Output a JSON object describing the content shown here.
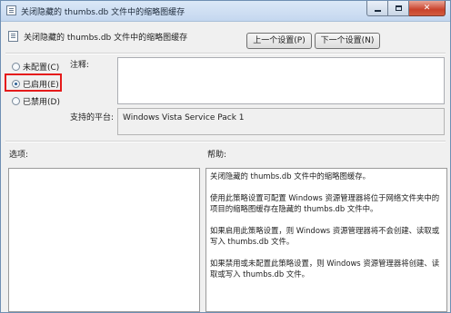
{
  "window": {
    "title": "关闭隐藏的 thumbs.db 文件中的缩略图缓存"
  },
  "header": {
    "policy_name": "关闭隐藏的 thumbs.db 文件中的缩略图缓存",
    "prev_button": "上一个设置(P)",
    "next_button": "下一个设置(N)"
  },
  "state_options": [
    {
      "label": "未配置(C)",
      "checked": false
    },
    {
      "label": "已启用(E)",
      "checked": true
    },
    {
      "label": "已禁用(D)",
      "checked": false
    }
  ],
  "comment": {
    "label": "注释:",
    "value": ""
  },
  "supported": {
    "label": "支持的平台:",
    "value": "Windows Vista Service Pack 1"
  },
  "options": {
    "label": "选项:"
  },
  "help": {
    "label": "帮助:",
    "paragraphs": [
      "关闭隐藏的 thumbs.db 文件中的缩略图缓存。",
      "使用此策略设置可配置 Windows 资源管理器将位于网络文件夹中的项目的缩略图缓存在隐藏的 thumbs.db 文件中。",
      "如果启用此策略设置，则 Windows 资源管理器将不会创建、读取或写入 thumbs.db 文件。",
      "如果禁用或未配置此策略设置，则 Windows 资源管理器将创建、读取或写入 thumbs.db 文件。"
    ]
  },
  "colors": {
    "highlight": "#e51b1b",
    "title_bar": "#c4d7ef",
    "close_button": "#c9432c"
  }
}
